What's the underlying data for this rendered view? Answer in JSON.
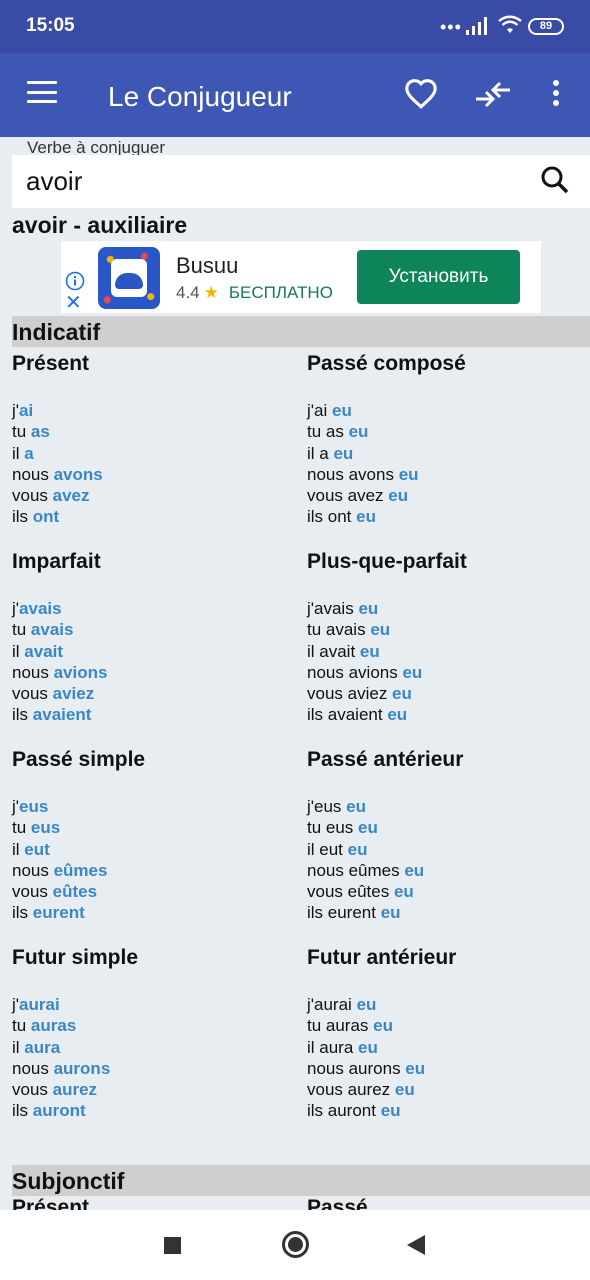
{
  "status": {
    "time": "15:05",
    "battery": "89"
  },
  "appbar": {
    "title": "Le Conjugueur"
  },
  "search": {
    "label": "Verbe à conjuguer",
    "value": "avoir"
  },
  "verb_title": "avoir - auxiliaire",
  "ad": {
    "name": "Busuu",
    "rating": "4.4",
    "price": "БЕСПЛАТНО",
    "install": "Установить"
  },
  "sections": [
    {
      "title": "Indicatif"
    },
    {
      "title": "Subjonctif"
    }
  ],
  "tenses": {
    "present": {
      "title": "Présent",
      "lines": [
        [
          "j'",
          "ai"
        ],
        [
          "tu ",
          "as"
        ],
        [
          "il ",
          "a"
        ],
        [
          "nous ",
          "avons"
        ],
        [
          "vous ",
          "avez"
        ],
        [
          "ils ",
          "ont"
        ]
      ]
    },
    "passe_compose": {
      "title": "Passé composé",
      "lines": [
        [
          "j'ai ",
          "eu"
        ],
        [
          "tu as ",
          "eu"
        ],
        [
          "il a ",
          "eu"
        ],
        [
          "nous avons ",
          "eu"
        ],
        [
          "vous avez ",
          "eu"
        ],
        [
          "ils ont ",
          "eu"
        ]
      ]
    },
    "imparfait": {
      "title": "Imparfait",
      "lines": [
        [
          "j'",
          "avais"
        ],
        [
          "tu ",
          "avais"
        ],
        [
          "il ",
          "avait"
        ],
        [
          "nous ",
          "avions"
        ],
        [
          "vous ",
          "aviez"
        ],
        [
          "ils ",
          "avaient"
        ]
      ]
    },
    "plus_que_parfait": {
      "title": "Plus-que-parfait",
      "lines": [
        [
          "j'avais ",
          "eu"
        ],
        [
          "tu avais ",
          "eu"
        ],
        [
          "il avait ",
          "eu"
        ],
        [
          "nous avions ",
          "eu"
        ],
        [
          "vous aviez ",
          "eu"
        ],
        [
          "ils avaient ",
          "eu"
        ]
      ]
    },
    "passe_simple": {
      "title": "Passé simple",
      "lines": [
        [
          "j'",
          "eus"
        ],
        [
          "tu ",
          "eus"
        ],
        [
          "il ",
          "eut"
        ],
        [
          "nous ",
          "eûmes"
        ],
        [
          "vous ",
          "eûtes"
        ],
        [
          "ils ",
          "eurent"
        ]
      ]
    },
    "passe_anterieur": {
      "title": "Passé antérieur",
      "lines": [
        [
          "j'eus ",
          "eu"
        ],
        [
          "tu eus ",
          "eu"
        ],
        [
          "il eut ",
          "eu"
        ],
        [
          "nous eûmes ",
          "eu"
        ],
        [
          "vous eûtes ",
          "eu"
        ],
        [
          "ils eurent ",
          "eu"
        ]
      ]
    },
    "futur_simple": {
      "title": "Futur simple",
      "lines": [
        [
          "j'",
          "aurai"
        ],
        [
          "tu ",
          "auras"
        ],
        [
          "il ",
          "aura"
        ],
        [
          "nous ",
          "aurons"
        ],
        [
          "vous ",
          "aurez"
        ],
        [
          "ils ",
          "auront"
        ]
      ]
    },
    "futur_anterieur": {
      "title": "Futur antérieur",
      "lines": [
        [
          "j'aurai ",
          "eu"
        ],
        [
          "tu auras ",
          "eu"
        ],
        [
          "il aura ",
          "eu"
        ],
        [
          "nous aurons ",
          "eu"
        ],
        [
          "vous aurez ",
          "eu"
        ],
        [
          "ils auront ",
          "eu"
        ]
      ]
    }
  },
  "cut_titles": {
    "left": "Présent",
    "right": "Passé"
  }
}
